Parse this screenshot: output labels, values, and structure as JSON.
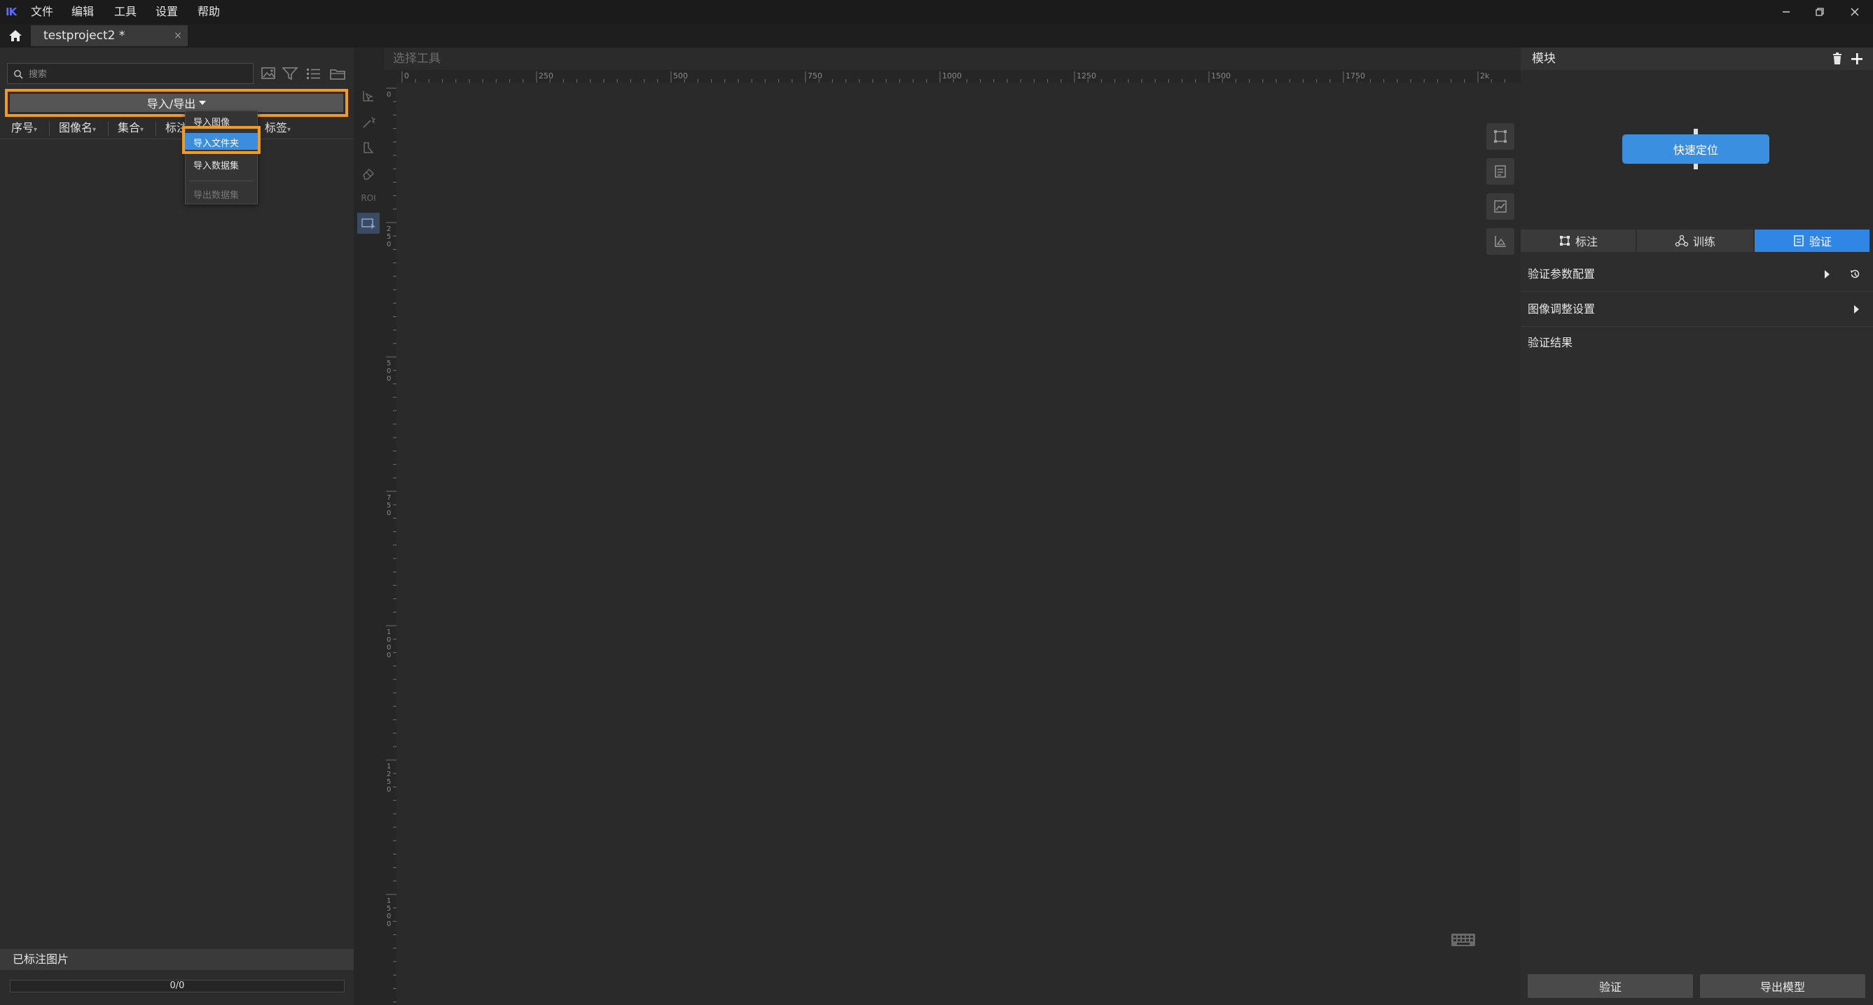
{
  "app": {
    "logo_text": "IK",
    "menu": [
      "文件",
      "编辑",
      "工具",
      "设置",
      "帮助"
    ]
  },
  "tab": {
    "title": "testproject2 *",
    "close": "×"
  },
  "left_panel": {
    "search_placeholder": "搜索",
    "import_export_label": "导入/导出",
    "columns": [
      "序号",
      "图像名",
      "集合",
      "标注",
      "标签"
    ],
    "dropdown_items": [
      "导入图像",
      "导入文件夹",
      "导入数据集",
      "导出数据集"
    ],
    "labeled_images_label": "已标注图片",
    "progress_text": "0/0",
    "progress": 0
  },
  "canvas": {
    "title": "选择工具",
    "ruler_top_labels": [
      "0",
      "250",
      "500",
      "750",
      "1000",
      "1250",
      "1500",
      "1750",
      "2k"
    ],
    "ruler_left_labels": [
      "0",
      "250",
      "500",
      "750",
      "1000",
      "1250",
      "1500"
    ],
    "roi_label": "ROI"
  },
  "right_panel": {
    "module_title": "模块",
    "node_label": "快速定位",
    "tabs": [
      "标注",
      "训练",
      "验证"
    ],
    "active_tab": "验证",
    "sections": [
      "验证参数配置",
      "图像调整设置",
      "验证结果"
    ],
    "buttons": [
      "验证",
      "导出模型"
    ]
  },
  "colors": {
    "accent": "#2f86e4",
    "highlight": "#f39a21",
    "node": "#3a8fe0"
  }
}
